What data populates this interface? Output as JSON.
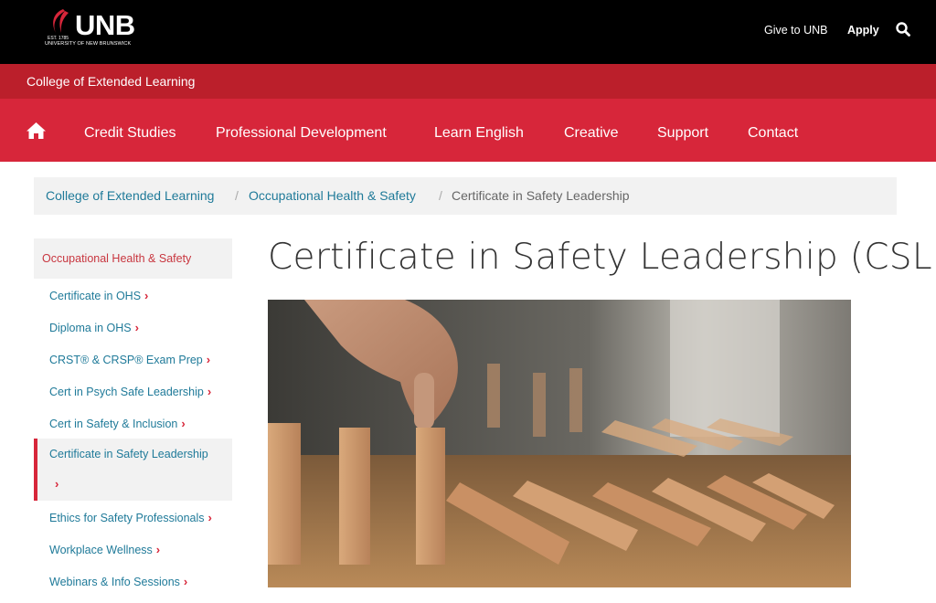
{
  "header": {
    "logo_text": "UNB",
    "logo_est": "EST. 1785",
    "logo_university": "UNIVERSITY OF NEW BRUNSWICK",
    "give_label": "Give to UNB",
    "apply_label": "Apply",
    "search_icon": "search-icon"
  },
  "college": {
    "name": "College of Extended Learning"
  },
  "nav": {
    "home_icon": "home-icon",
    "items": [
      {
        "label": "Credit Studies"
      },
      {
        "label": "Professional Development"
      },
      {
        "label": "Learn English"
      },
      {
        "label": "Creative"
      },
      {
        "label": "Support"
      },
      {
        "label": "Contact"
      }
    ]
  },
  "breadcrumb": {
    "items": [
      {
        "label": "College of Extended Learning"
      },
      {
        "label": "Occupational Health & Safety"
      },
      {
        "label": "Certificate in Safety Leadership"
      }
    ],
    "separator": "/"
  },
  "sidebar": {
    "heading": "Occupational Health & Safety",
    "items": [
      {
        "label": "Certificate in OHS"
      },
      {
        "label": "Diploma in OHS"
      },
      {
        "label": "CRST® & CRSP® Exam Prep"
      },
      {
        "label": "Cert in Psych Safe Leadership"
      },
      {
        "label": "Cert in Safety & Inclusion"
      },
      {
        "label": "Certificate in Safety Leadership"
      },
      {
        "label": "Ethics for Safety Professionals"
      },
      {
        "label": "Workplace Wellness"
      },
      {
        "label": "Webinars & Info Sessions"
      }
    ],
    "active_index": 5,
    "chevron": "›"
  },
  "main": {
    "title": "Certificate in Safety Leadership (CSL)"
  },
  "colors": {
    "black_bar": "#000000",
    "college_bar": "#bb1f2b",
    "nav_bar": "#d7263a",
    "link": "#1f7a99"
  }
}
